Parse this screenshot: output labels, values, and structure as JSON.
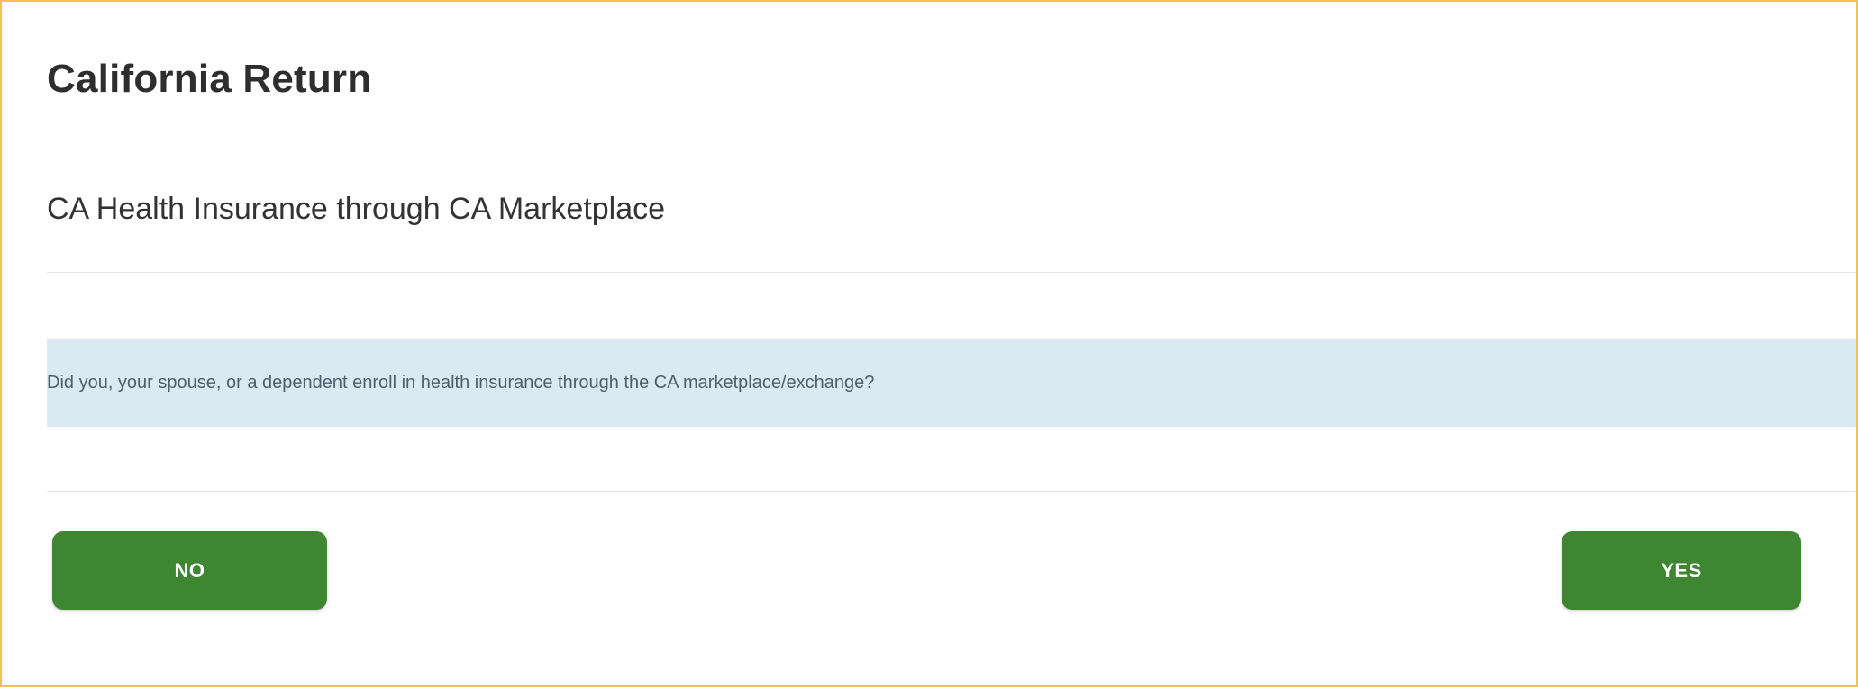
{
  "page": {
    "title": "California Return",
    "section_title": "CA Health Insurance through CA Marketplace",
    "question": "Did you, your spouse, or a dependent enroll in health insurance through the CA marketplace/exchange?"
  },
  "actions": {
    "no_label": "NO",
    "yes_label": "YES"
  },
  "colors": {
    "frame_border": "#f3c34a",
    "button_background": "#3f8633",
    "question_background": "#dbe9f2"
  }
}
